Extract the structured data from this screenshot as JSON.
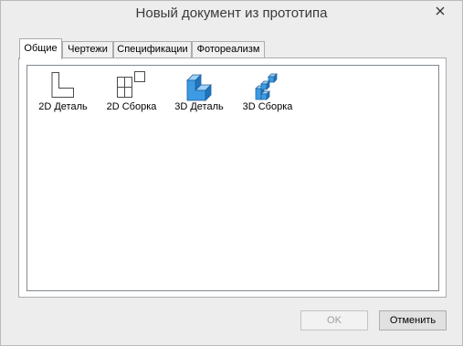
{
  "window": {
    "title": "Новый документ из прототипа"
  },
  "tabs": [
    {
      "label": "Общие",
      "active": true
    },
    {
      "label": "Чертежи",
      "active": false
    },
    {
      "label": "Спецификации",
      "active": false
    },
    {
      "label": "Фотореализм",
      "active": false
    }
  ],
  "items": [
    {
      "label": "2D Деталь",
      "icon": "2d-part-icon"
    },
    {
      "label": "2D Сборка",
      "icon": "2d-assembly-icon"
    },
    {
      "label": "3D Деталь",
      "icon": "3d-part-icon"
    },
    {
      "label": "3D Сборка",
      "icon": "3d-assembly-icon"
    }
  ],
  "buttons": {
    "ok": "OK",
    "cancel": "Отменить"
  },
  "colors": {
    "accent_blue": "#2f8fd8",
    "border": "#acacac"
  }
}
